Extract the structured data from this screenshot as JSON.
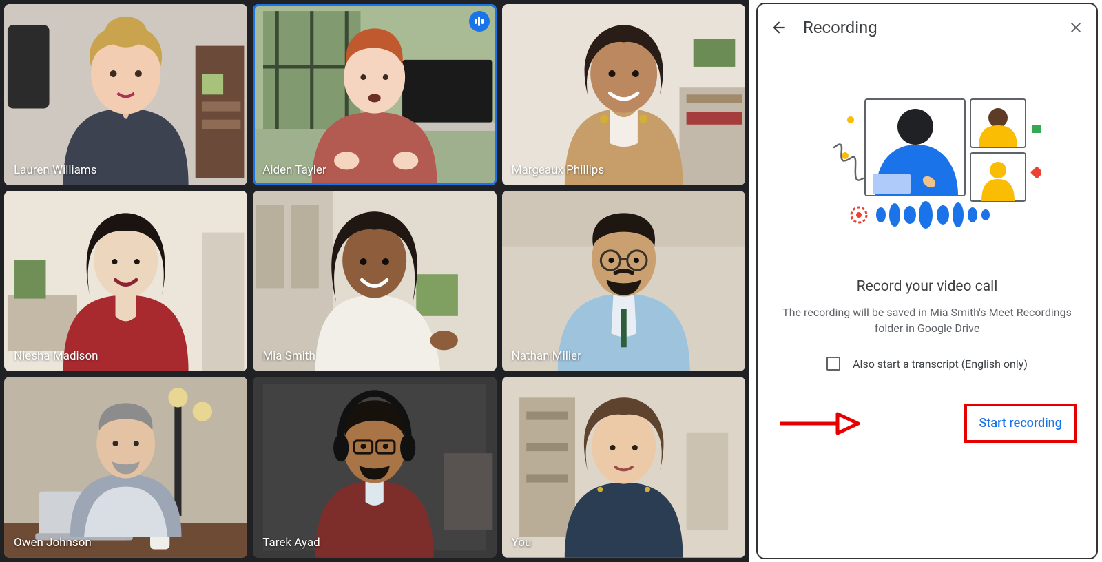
{
  "participants": [
    {
      "name": "Lauren Williams",
      "active": false
    },
    {
      "name": "Aiden Tayler",
      "active": true
    },
    {
      "name": "Margeaux Phillips",
      "active": false
    },
    {
      "name": "Niesha Madison",
      "active": false
    },
    {
      "name": "Mia Smith",
      "active": false
    },
    {
      "name": "Nathan Miller",
      "active": false
    },
    {
      "name": "Owen Johnson",
      "active": false
    },
    {
      "name": "Tarek Ayad",
      "active": false
    },
    {
      "name": "You",
      "active": false
    }
  ],
  "panel": {
    "title": "Recording",
    "heading": "Record your video call",
    "description": "The recording will be saved in Mia Smith's Meet Recordings folder in Google Drive",
    "checkbox_label": "Also start a transcript (English only)",
    "start_label": "Start recording"
  }
}
